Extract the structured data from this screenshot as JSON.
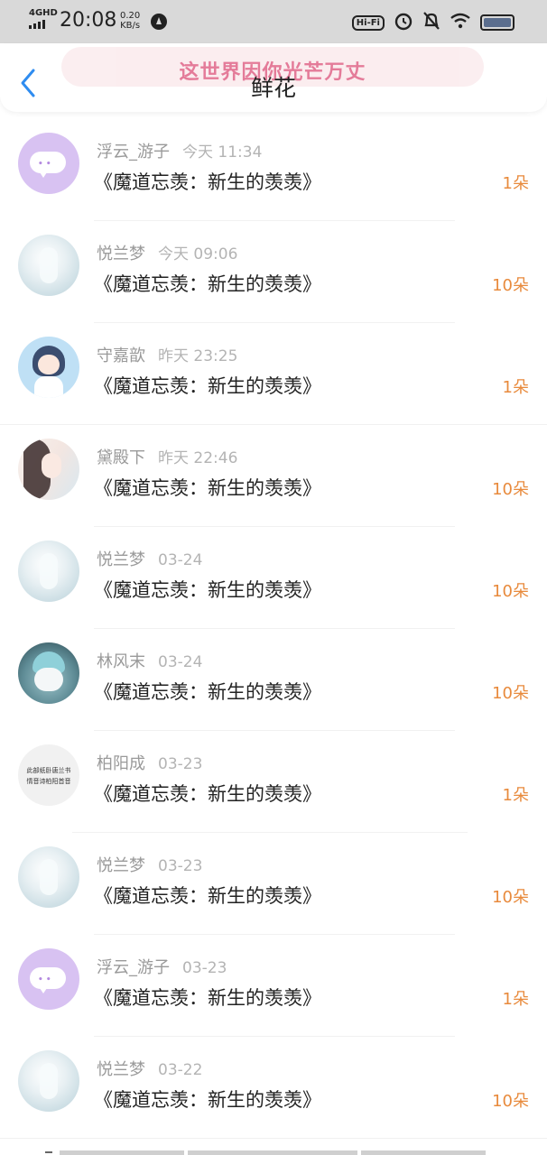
{
  "status_bar": {
    "network": "4GHD",
    "time": "20:08",
    "speed_value": "0.20",
    "speed_unit": "KB/s",
    "hifi": "Hi-Fi"
  },
  "header": {
    "banner": "这世界因你光芒万丈",
    "title": "鲜花"
  },
  "items": [
    {
      "name": "浮云_游子",
      "when": "今天 11:34",
      "book": "《魔道忘羡：新生的羡羡》",
      "amount": "1朵",
      "avatar": "chat-bubble"
    },
    {
      "name": "悦兰梦",
      "when": "今天 09:06",
      "book": "《魔道忘羡：新生的羡羡》",
      "amount": "10朵",
      "avatar": "flower"
    },
    {
      "name": "守嘉歆",
      "when": "昨天 23:25",
      "book": "《魔道忘羡：新生的羡羡》",
      "amount": "1朵",
      "avatar": "anime-girl"
    },
    {
      "name": "黛殿下",
      "when": "昨天 22:46",
      "book": "《魔道忘羡：新生的羡羡》",
      "amount": "10朵",
      "avatar": "lady"
    },
    {
      "name": "悦兰梦",
      "when": "03-24",
      "book": "《魔道忘羡：新生的羡羡》",
      "amount": "10朵",
      "avatar": "flower"
    },
    {
      "name": "林风末",
      "when": "03-24",
      "book": "《魔道忘羡：新生的羡羡》",
      "amount": "10朵",
      "avatar": "cat"
    },
    {
      "name": "柏阳成",
      "when": "03-23",
      "book": "《魔道忘羡：新生的羡羡》",
      "amount": "1朵",
      "avatar": "text"
    },
    {
      "name": "悦兰梦",
      "when": "03-23",
      "book": "《魔道忘羡：新生的羡羡》",
      "amount": "10朵",
      "avatar": "flower"
    },
    {
      "name": "浮云_游子",
      "when": "03-23",
      "book": "《魔道忘羡：新生的羡羡》",
      "amount": "1朵",
      "avatar": "chat-bubble"
    },
    {
      "name": "悦兰梦",
      "when": "03-22",
      "book": "《魔道忘羡：新生的羡羡》",
      "amount": "10朵",
      "avatar": "flower"
    }
  ],
  "avatar_text_lines": [
    "此部纸卧唐兰书",
    "情音诗柏阳首音"
  ],
  "colors": {
    "accent_blue": "#2f8cf0",
    "amount_orange": "#e88a3c",
    "banner_pink": "#e26d8f"
  }
}
